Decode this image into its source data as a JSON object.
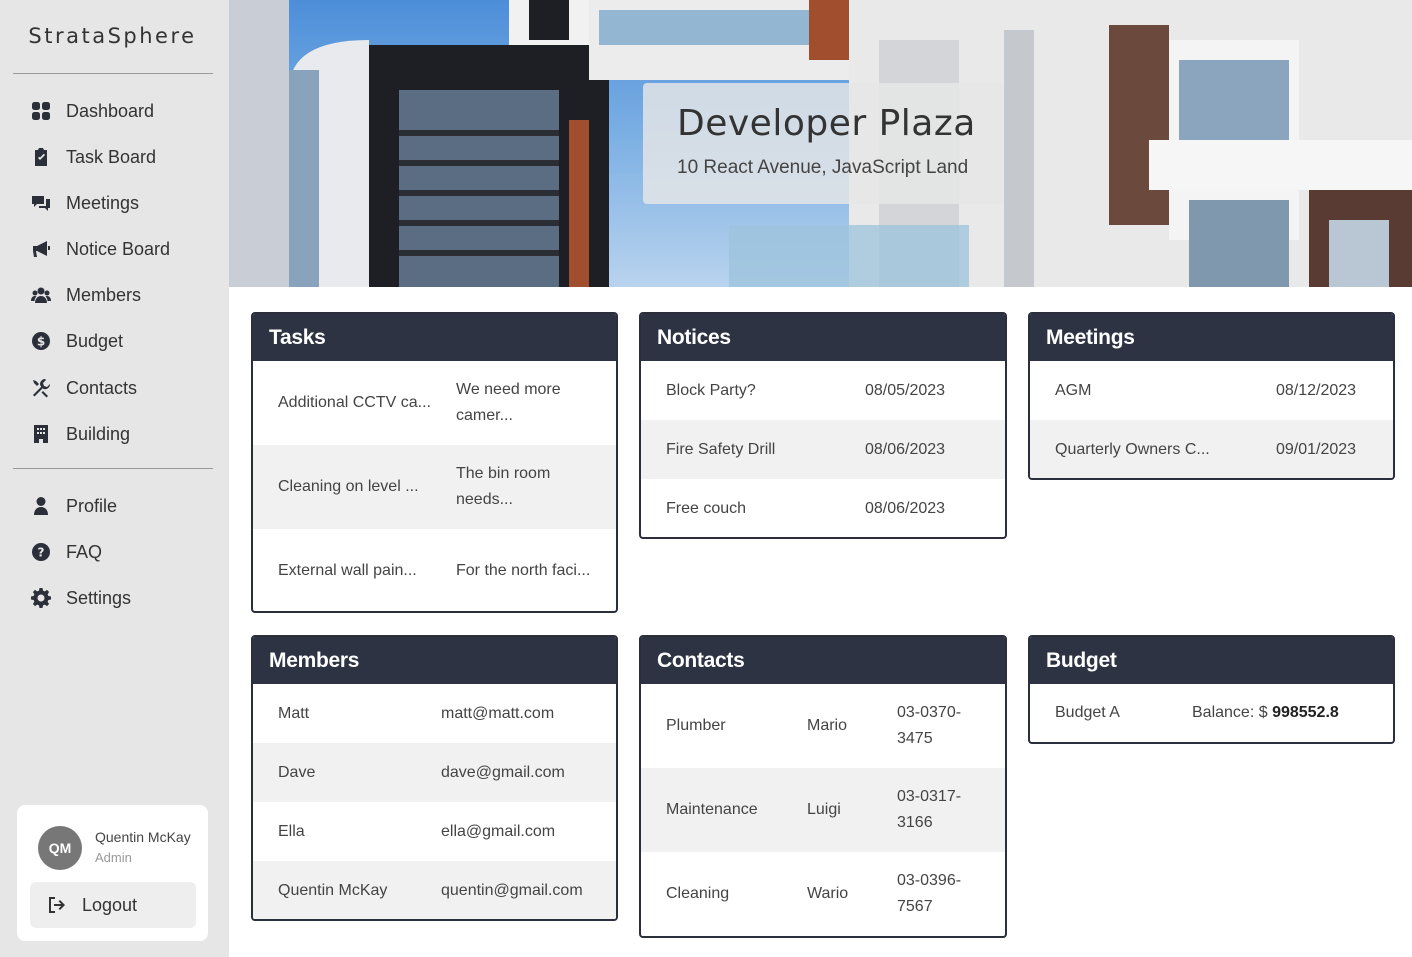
{
  "brand": "StrataSphere",
  "nav": {
    "dashboard": "Dashboard",
    "task_board": "Task Board",
    "meetings": "Meetings",
    "notice_board": "Notice Board",
    "members": "Members",
    "budget": "Budget",
    "contacts": "Contacts",
    "building": "Building",
    "profile": "Profile",
    "faq": "FAQ",
    "settings": "Settings"
  },
  "user": {
    "initials": "QM",
    "name": "Quentin McKay",
    "role": "Admin",
    "logout": "Logout"
  },
  "building": {
    "name": "Developer Plaza",
    "address": "10 React Avenue, JavaScript Land"
  },
  "tasks": {
    "title": "Tasks",
    "rows": [
      {
        "name": "Additional CCTV ca...",
        "desc": "We need more camer..."
      },
      {
        "name": "Cleaning on level ...",
        "desc": "The bin room needs..."
      },
      {
        "name": "External wall pain...",
        "desc": "For the north faci..."
      }
    ]
  },
  "notices": {
    "title": "Notices",
    "rows": [
      {
        "name": "Block Party?",
        "date": "08/05/2023"
      },
      {
        "name": "Fire Safety Drill",
        "date": "08/06/2023"
      },
      {
        "name": "Free couch",
        "date": "08/06/2023"
      }
    ]
  },
  "meetings": {
    "title": "Meetings",
    "rows": [
      {
        "name": "AGM",
        "date": "08/12/2023"
      },
      {
        "name": "Quarterly Owners C...",
        "date": "09/01/2023"
      }
    ]
  },
  "members": {
    "title": "Members",
    "rows": [
      {
        "name": "Matt",
        "email": "matt@matt.com"
      },
      {
        "name": "Dave",
        "email": "dave@gmail.com"
      },
      {
        "name": "Ella",
        "email": "ella@gmail.com"
      },
      {
        "name": "Quentin McKay",
        "email": "quentin@gmail.com"
      }
    ]
  },
  "contacts": {
    "title": "Contacts",
    "rows": [
      {
        "role": "Plumber",
        "name": "Mario",
        "phone": "03-0370-3475"
      },
      {
        "role": "Maintenance",
        "name": "Luigi",
        "phone": "03-0317-3166"
      },
      {
        "role": "Cleaning",
        "name": "Wario",
        "phone": "03-0396-7567"
      }
    ]
  },
  "budget": {
    "title": "Budget",
    "rows": [
      {
        "name": "Budget A",
        "balance_label": "Balance: $",
        "balance": "998552.8"
      }
    ]
  }
}
